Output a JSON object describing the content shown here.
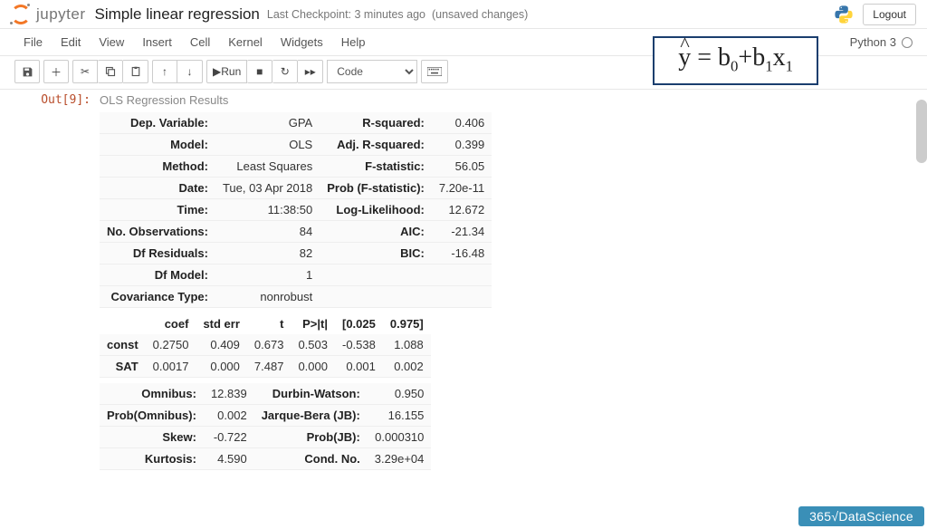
{
  "header": {
    "brand": "jupyter",
    "notebook_title": "Simple linear regression",
    "checkpoint": "Last Checkpoint: 3 minutes ago",
    "unsaved": "(unsaved changes)",
    "logout": "Logout"
  },
  "menu": {
    "items": [
      "File",
      "Edit",
      "View",
      "Insert",
      "Cell",
      "Kernel",
      "Widgets",
      "Help"
    ],
    "kernel_name": "Python 3"
  },
  "toolbar": {
    "run_label": "Run",
    "cell_type_selected": "Code"
  },
  "equation": "ŷ = b0 + b1 x1",
  "cell": {
    "prompt": "Out[9]:",
    "caption": "OLS Regression Results",
    "summary1": [
      {
        "k": "Dep. Variable:",
        "v": "GPA",
        "k2": "R-squared:",
        "v2": "0.406"
      },
      {
        "k": "Model:",
        "v": "OLS",
        "k2": "Adj. R-squared:",
        "v2": "0.399"
      },
      {
        "k": "Method:",
        "v": "Least Squares",
        "k2": "F-statistic:",
        "v2": "56.05"
      },
      {
        "k": "Date:",
        "v": "Tue, 03 Apr 2018",
        "k2": "Prob (F-statistic):",
        "v2": "7.20e-11"
      },
      {
        "k": "Time:",
        "v": "11:38:50",
        "k2": "Log-Likelihood:",
        "v2": "12.672"
      },
      {
        "k": "No. Observations:",
        "v": "84",
        "k2": "AIC:",
        "v2": "-21.34"
      },
      {
        "k": "Df Residuals:",
        "v": "82",
        "k2": "BIC:",
        "v2": "-16.48"
      },
      {
        "k": "Df Model:",
        "v": "1",
        "k2": "",
        "v2": ""
      },
      {
        "k": "Covariance Type:",
        "v": "nonrobust",
        "k2": "",
        "v2": ""
      }
    ],
    "coef_headers": [
      "",
      "coef",
      "std err",
      "t",
      "P>|t|",
      "[0.025",
      "0.975]"
    ],
    "coef_rows": [
      {
        "name": "const",
        "vals": [
          "0.2750",
          "0.409",
          "0.673",
          "0.503",
          "-0.538",
          "1.088"
        ]
      },
      {
        "name": "SAT",
        "vals": [
          "0.0017",
          "0.000",
          "7.487",
          "0.000",
          "0.001",
          "0.002"
        ]
      }
    ],
    "diag": [
      {
        "k": "Omnibus:",
        "v": "12.839",
        "k2": "Durbin-Watson:",
        "v2": "0.950"
      },
      {
        "k": "Prob(Omnibus):",
        "v": "0.002",
        "k2": "Jarque-Bera (JB):",
        "v2": "16.155"
      },
      {
        "k": "Skew:",
        "v": "-0.722",
        "k2": "Prob(JB):",
        "v2": "0.000310"
      },
      {
        "k": "Kurtosis:",
        "v": "4.590",
        "k2": "Cond. No.",
        "v2": "3.29e+04"
      }
    ]
  },
  "watermark": "365√DataScience"
}
